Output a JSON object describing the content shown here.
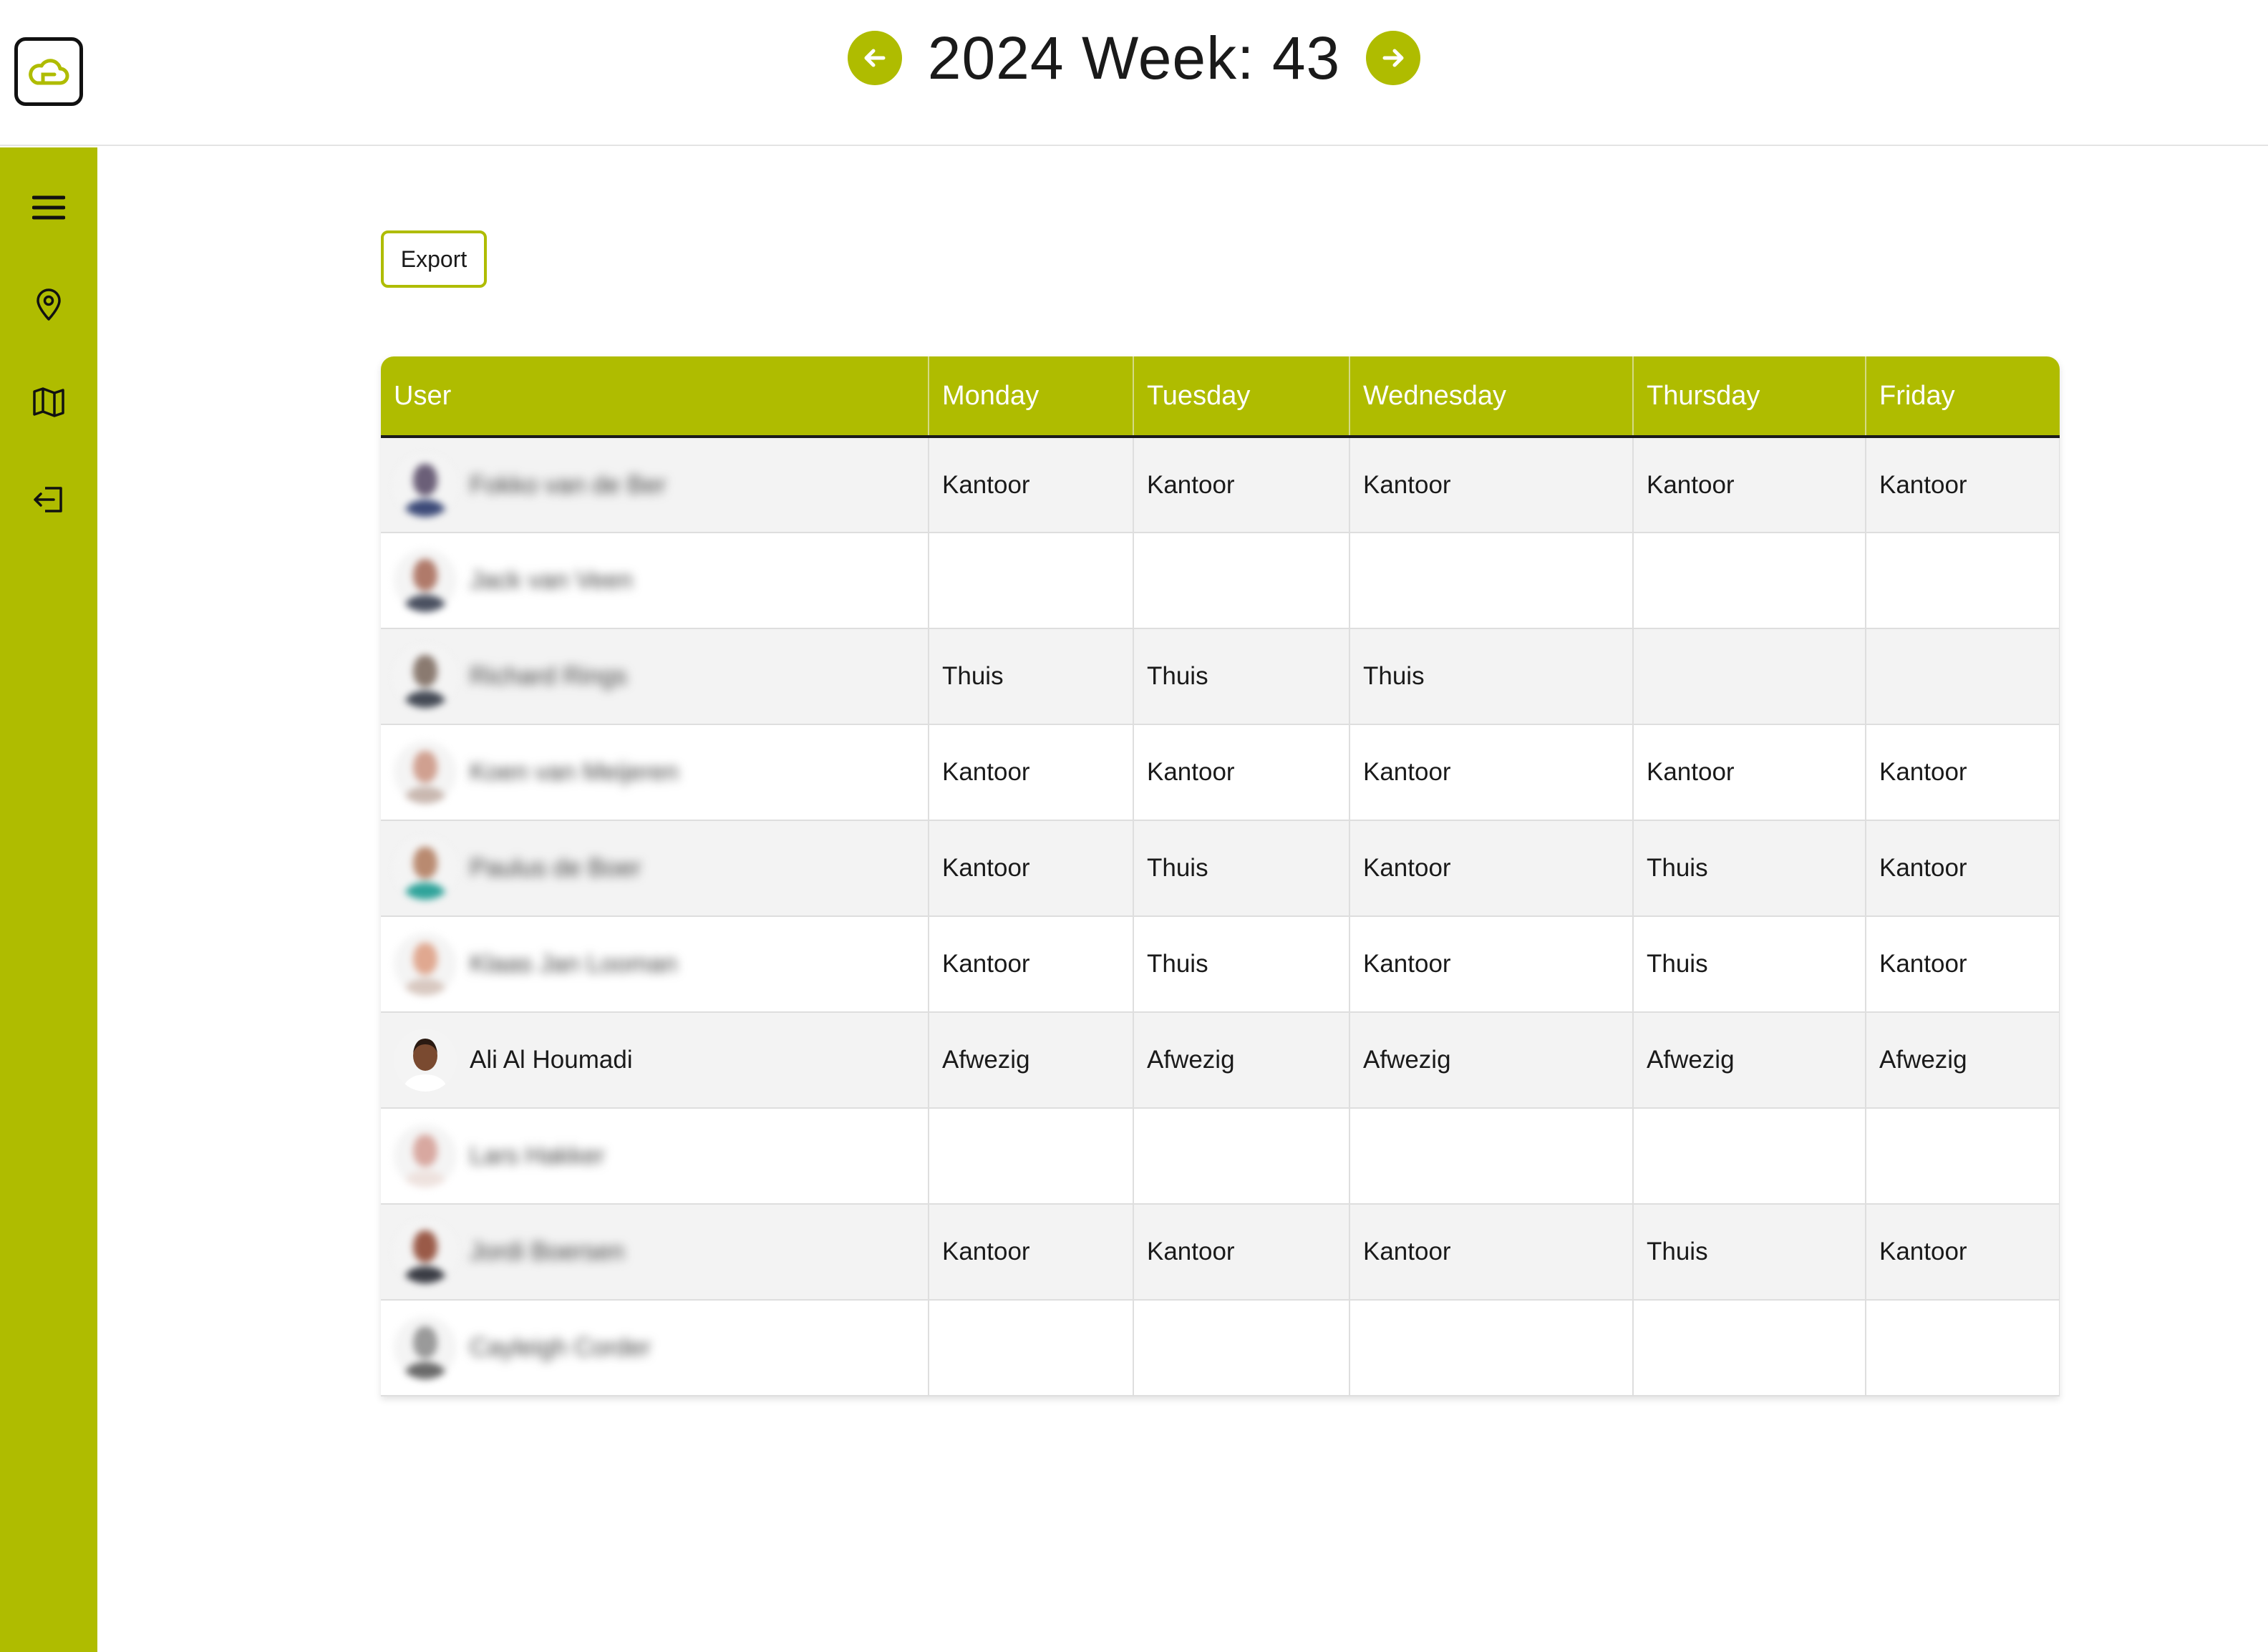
{
  "header": {
    "title": "2024 Week: 43",
    "prev_icon": "arrow-left-icon",
    "next_icon": "arrow-right-icon",
    "logo_icon": "cloud-logo-icon"
  },
  "colors": {
    "accent": "#afbc00",
    "header_text": "#ffffff",
    "row_alt": "#f3f3f3"
  },
  "sidebar": {
    "items": [
      {
        "icon": "menu-icon"
      },
      {
        "icon": "location-pin-icon"
      },
      {
        "icon": "map-icon"
      },
      {
        "icon": "logout-icon"
      }
    ]
  },
  "toolbar": {
    "export_label": "Export"
  },
  "table": {
    "columns": [
      "User",
      "Monday",
      "Tuesday",
      "Wednesday",
      "Thursday",
      "Friday"
    ],
    "rows": [
      {
        "name": "Fokko van de Ber",
        "blurred": true,
        "days": [
          "Kantoor",
          "Kantoor",
          "Kantoor",
          "Kantoor",
          "Kantoor"
        ]
      },
      {
        "name": "Jack van Veen",
        "blurred": true,
        "days": [
          "",
          "",
          "",
          "",
          ""
        ]
      },
      {
        "name": "Richard Rings",
        "blurred": true,
        "days": [
          "Thuis",
          "Thuis",
          "Thuis",
          "",
          ""
        ]
      },
      {
        "name": "Koen van Meijeren",
        "blurred": true,
        "days": [
          "Kantoor",
          "Kantoor",
          "Kantoor",
          "Kantoor",
          "Kantoor"
        ]
      },
      {
        "name": "Paulus de Boer",
        "blurred": true,
        "days": [
          "Kantoor",
          "Thuis",
          "Kantoor",
          "Thuis",
          "Kantoor"
        ]
      },
      {
        "name": "Klaas Jan Looman",
        "blurred": true,
        "days": [
          "Kantoor",
          "Thuis",
          "Kantoor",
          "Thuis",
          "Kantoor"
        ]
      },
      {
        "name": "Ali Al Houmadi",
        "blurred": false,
        "days": [
          "Afwezig",
          "Afwezig",
          "Afwezig",
          "Afwezig",
          "Afwezig"
        ]
      },
      {
        "name": "Lars Hakker",
        "blurred": true,
        "days": [
          "",
          "",
          "",
          "",
          ""
        ]
      },
      {
        "name": "Jordi Boersen",
        "blurred": true,
        "days": [
          "Kantoor",
          "Kantoor",
          "Kantoor",
          "Thuis",
          "Kantoor"
        ]
      },
      {
        "name": "Cayleigh Corder",
        "blurred": true,
        "days": [
          "",
          "",
          "",
          "",
          ""
        ]
      }
    ]
  }
}
